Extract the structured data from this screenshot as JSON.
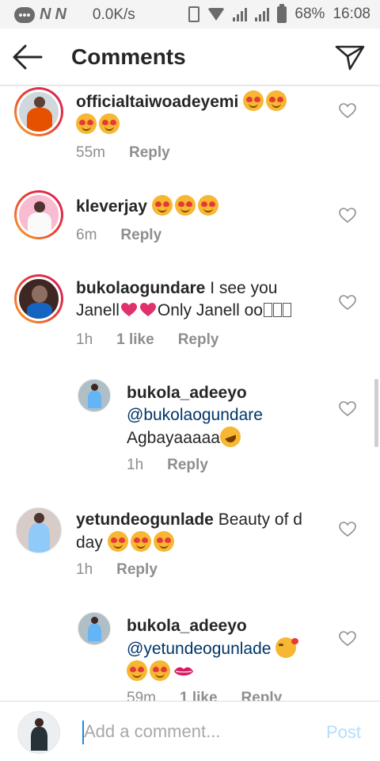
{
  "status_bar": {
    "speed": "0.0K/s",
    "battery": "68%",
    "time": "16:08",
    "icons": [
      "chat-icon",
      "n-icon",
      "n-icon",
      "vibrate-icon",
      "wifi-icon",
      "signal-icon",
      "battery-icon"
    ]
  },
  "header": {
    "title": "Comments",
    "back_icon": "arrow-left-icon",
    "share_icon": "send-icon"
  },
  "comments": [
    {
      "username": "officialtaiwoadeyemi",
      "text": "",
      "emojis": [
        "heart-eyes",
        "heart-eyes",
        "heart-eyes",
        "heart-eyes"
      ],
      "time": "55m",
      "likes": "",
      "reply": "Reply"
    },
    {
      "username": "kleverjay",
      "text": "",
      "emojis": [
        "heart-eyes",
        "heart-eyes",
        "heart-eyes"
      ],
      "time": "6m",
      "likes": "",
      "reply": "Reply"
    },
    {
      "username": "bukolaogundare",
      "text_1": "I see you",
      "text_2": "Janell",
      "text_3": "Only Janell oo",
      "time": "1h",
      "likes": "1 like",
      "reply": "Reply"
    },
    {
      "username": "bukola_adeeyo",
      "mention": "@bukolaogundare",
      "text": "Agbayaaaaa",
      "time": "1h",
      "likes": "",
      "reply": "Reply"
    },
    {
      "username": "yetundeogunlade",
      "text_1": "Beauty of d",
      "text_2": "day",
      "time": "1h",
      "likes": "",
      "reply": "Reply"
    },
    {
      "username": "bukola_adeeyo",
      "mention": "@yetundeogunlade",
      "time": "59m",
      "likes": "1 like",
      "reply": "Reply"
    }
  ],
  "composer": {
    "placeholder": "Add a comment...",
    "post_label": "Post"
  },
  "colors": {
    "link_blue": "#003569",
    "meta_gray": "#8e8e8e",
    "post_disabled": "#b2dffc",
    "story_ring": "#e53935"
  }
}
